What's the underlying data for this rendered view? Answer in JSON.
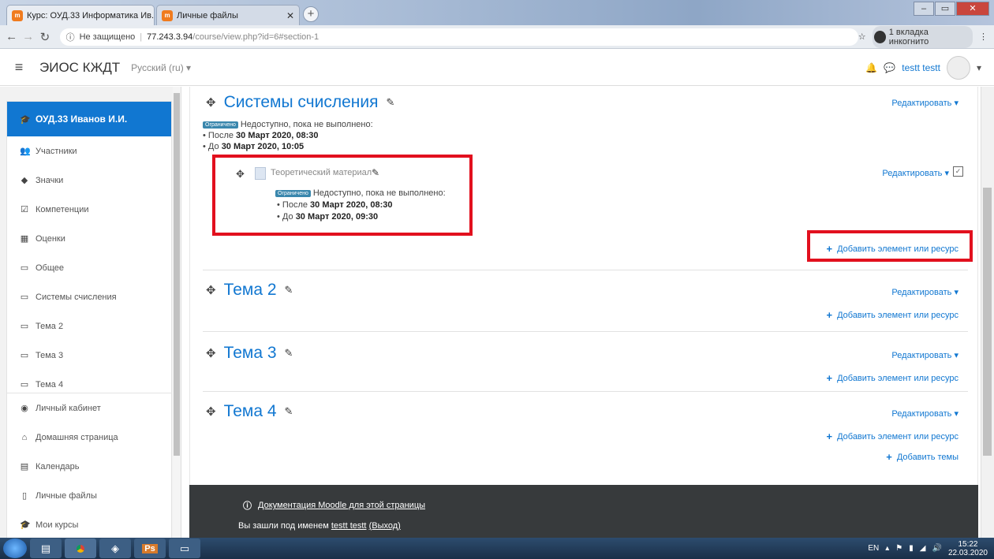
{
  "browser": {
    "tabs": [
      {
        "title": "Курс: ОУД.33 Информатика Ив...",
        "favicon": "m"
      },
      {
        "title": "Личные файлы",
        "favicon": "m"
      }
    ],
    "security": "Не защищено",
    "url_host": "77.243.3.94",
    "url_path": "/course/view.php?id=6#section-1",
    "incognito": "1 вкладка инкогнито"
  },
  "navbar": {
    "site_name": "ЭИОС КЖДТ",
    "language": "Русский (ru)",
    "user_name": "testt testt"
  },
  "sidebar": {
    "course": "ОУД.33 Иванов И.И.",
    "items": [
      {
        "label": "Участники",
        "icon": "users-icon",
        "glyph": "👥"
      },
      {
        "label": "Значки",
        "icon": "shield-icon",
        "glyph": "◆"
      },
      {
        "label": "Компетенции",
        "icon": "checkbox-icon",
        "glyph": "☑"
      },
      {
        "label": "Оценки",
        "icon": "table-icon",
        "glyph": "▦"
      },
      {
        "label": "Общее",
        "icon": "folder-icon",
        "glyph": "▭"
      },
      {
        "label": "Системы счисления",
        "icon": "folder-icon",
        "glyph": "▭"
      },
      {
        "label": "Тема 2",
        "icon": "folder-icon",
        "glyph": "▭"
      },
      {
        "label": "Тема 3",
        "icon": "folder-icon",
        "glyph": "▭"
      },
      {
        "label": "Тема 4",
        "icon": "folder-icon",
        "glyph": "▭"
      }
    ],
    "items2": [
      {
        "label": "Личный кабинет",
        "icon": "dashboard-icon",
        "glyph": "◉"
      },
      {
        "label": "Домашняя страница",
        "icon": "home-icon",
        "glyph": "⌂"
      },
      {
        "label": "Календарь",
        "icon": "calendar-icon",
        "glyph": "▤"
      },
      {
        "label": "Личные файлы",
        "icon": "file-icon",
        "glyph": "▯"
      },
      {
        "label": "Мои курсы",
        "icon": "graduation-cap-icon",
        "glyph": "🎓"
      }
    ]
  },
  "sections": {
    "s1": {
      "title": "Системы счисления",
      "edit": "Редактировать",
      "badge": "Ограничено",
      "restrict_text": "Недоступно, пока не выполнено:",
      "after_prefix": "После",
      "after_date": "30 Март 2020, 08:30",
      "before_prefix": "До",
      "before_date": "30 Март 2020, 10:05",
      "activity": {
        "title": "Теоретический материал",
        "edit": "Редактировать",
        "badge": "Ограничено",
        "restrict_text": "Недоступно, пока не выполнено:",
        "after_prefix": "После",
        "after_date": "30 Март 2020, 08:30",
        "before_prefix": "До",
        "before_date": "30 Март 2020, 09:30"
      },
      "add": "Добавить элемент или ресурс"
    },
    "s2": {
      "title": "Тема 2",
      "edit": "Редактировать",
      "add": "Добавить элемент или ресурс"
    },
    "s3": {
      "title": "Тема 3",
      "edit": "Редактировать",
      "add": "Добавить элемент или ресурс"
    },
    "s4": {
      "title": "Тема 4",
      "edit": "Редактировать",
      "add": "Добавить элемент или ресурс"
    },
    "add_topics": "Добавить темы"
  },
  "footer": {
    "doc_link": "Документация Moodle для этой страницы",
    "logged_prefix": "Вы зашли под именем",
    "logged_user": "testt testt",
    "logout": "(Выход)"
  },
  "taskbar": {
    "lang": "EN",
    "time": "15:22",
    "date": "22.03.2020"
  },
  "colors": {
    "accent": "#1177d1",
    "highlight": "#e2101e",
    "footer": "#373a3c"
  }
}
